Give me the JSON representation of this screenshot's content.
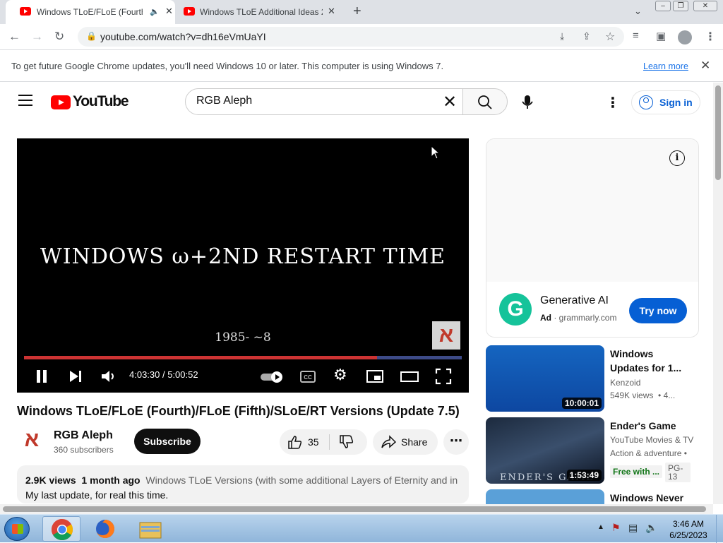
{
  "browser": {
    "tabs": [
      {
        "title": "Windows TLoE/FLoE (Fourth",
        "active": true
      },
      {
        "title": "Windows TLoE Additional Ideas 2",
        "active": false
      }
    ],
    "url": "youtube.com/watch?v=dh16eVmUaYI",
    "new_tab": "+",
    "infobar": {
      "message": "To get future Google Chrome updates, you'll need Windows 10 or later. This computer is using Windows 7.",
      "link": "Learn more"
    }
  },
  "youtube": {
    "wordmark": "YouTube",
    "search_value": "RGB Aleph",
    "sign_in": "Sign in"
  },
  "player": {
    "video_text": "WINDOWS ω+2ND RESTART TIME",
    "video_year": "1985- ~8",
    "watermark": "א",
    "time": "4:03:30 / 5:00:52",
    "progress": 0.807,
    "buffered": 1.0
  },
  "video": {
    "title": "Windows TLoE/FLoE (Fourth)/FLoE (Fifth)/SLoE/RT Versions (Update 7.5)",
    "channel": "RGB Aleph",
    "channel_avatar": "א",
    "subscribers": "360 subscribers",
    "subscribe": "Subscribe",
    "likes": "35",
    "share": "Share",
    "views": "2.9K views",
    "age": "1 month ago",
    "desc_first": "Windows TLoE Versions (with some additional Layers of Eternity and inc",
    "desc_second": "My last update, for real this time."
  },
  "ad": {
    "headline": "Generative AI",
    "label": "Ad",
    "domain": "grammarly.com",
    "cta": "Try now",
    "logo_letter": "G"
  },
  "recommendations": [
    {
      "title": "Windows Updates for 1...",
      "channel": "Kenzoid",
      "meta": "549K views",
      "meta_extra": "• 4...",
      "duration": "10:00:01"
    },
    {
      "title": "Ender's Game",
      "channel": "YouTube Movies & TV",
      "meta": "Action & adventure •",
      "badge_free": "Free with ...",
      "badge_rating": "PG-13",
      "duration": "1:53:49",
      "thumb_caption": "ENDER'S GAME"
    },
    {
      "title": "Windows Never",
      "channel": "",
      "meta": ""
    }
  ],
  "taskbar": {
    "time": "3:46 AM",
    "date": "6/25/2023"
  }
}
